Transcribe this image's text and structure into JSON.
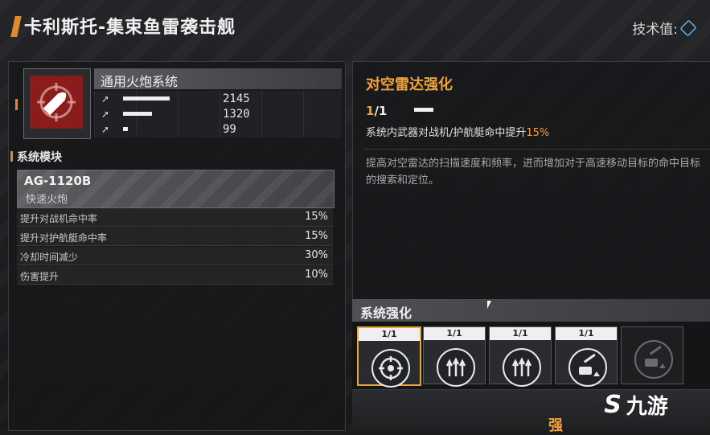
{
  "header": {
    "title": "卡利斯托-集束鱼雷袭击舰",
    "tech_label": "技术值:"
  },
  "system": {
    "name": "通用火炮系统",
    "stats": [
      {
        "icon": "attack-icon",
        "value": "2145",
        "fill": 0.48
      },
      {
        "icon": "rate-icon",
        "value": "1320",
        "fill": 0.3
      },
      {
        "icon": "range-icon",
        "value": "99",
        "fill": 0.05
      }
    ]
  },
  "modules": {
    "section_title": "系统模块",
    "card": {
      "code": "AG-1120B",
      "type": "快速火炮"
    },
    "rows": [
      {
        "label": "提升对战机命中率",
        "value": "15%"
      },
      {
        "label": "提升对护航艇命中率",
        "value": "15%"
      },
      {
        "label": "冷却时间减少",
        "value": "30%"
      },
      {
        "label": "伤害提升",
        "value": "10%"
      }
    ]
  },
  "enhancement": {
    "title": "对空雷达强化",
    "level_current": "1",
    "level_sep": "/",
    "level_max": "1",
    "effect_text": "系统内武器对战机/护航艇命中提升",
    "effect_pct": "15%",
    "description": "提高对空雷达的扫描速度和频率，进而增加对于高速移动目标的命中目标的搜索和定位。"
  },
  "system_enhance": {
    "title": "系统强化",
    "slots": [
      {
        "level": "1/1",
        "icon": "radar-target-icon",
        "active": true,
        "locked": false
      },
      {
        "level": "1/1",
        "icon": "triple-missile-icon",
        "active": false,
        "locked": false
      },
      {
        "level": "1/1",
        "icon": "triple-missile-icon",
        "active": false,
        "locked": false
      },
      {
        "level": "1/1",
        "icon": "turret-upgrade-icon",
        "active": false,
        "locked": false
      },
      {
        "level": "",
        "icon": "turret-upgrade-icon",
        "active": false,
        "locked": true
      }
    ],
    "footer_text": "强"
  },
  "watermark": {
    "text": "九游"
  },
  "colors": {
    "accent": "#e08a2a",
    "highlight": "#f0a13a",
    "icon_bg": "#8a1c1c",
    "tech": "#5aa9e6"
  }
}
